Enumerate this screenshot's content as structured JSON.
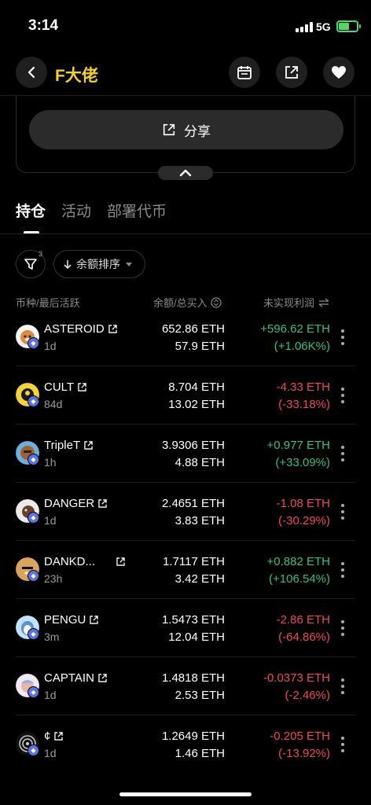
{
  "status_bar": {
    "time": "3:14",
    "network": "5G"
  },
  "header": {
    "title": "F大佬"
  },
  "share": {
    "label": "分享"
  },
  "tabs": [
    {
      "label": "持仓",
      "active": true
    },
    {
      "label": "活动",
      "active": false
    },
    {
      "label": "部署代币",
      "active": false
    }
  ],
  "filter": {
    "count": "3"
  },
  "sort": {
    "label": "余额排序"
  },
  "columns": {
    "token": "币种/最后活跃",
    "balance": "余额/总买入",
    "pnl": "未实现利润"
  },
  "colors": {
    "accent": "#f5d020",
    "positive": "#2ec27e",
    "negative": "#f0475a",
    "chain_badge": "#5b72e6"
  },
  "holdings": [
    {
      "symbol": "ASTEROID",
      "age": "1d",
      "balance": "652.86 ETH",
      "bought": "57.9 ETH",
      "pnl": "+596.62 ETH",
      "pnl_pct": "(+1.06K%)",
      "positive": true,
      "avatar": "asteroid-shiba-icon"
    },
    {
      "symbol": "CULT",
      "age": "84d",
      "balance": "8.704 ETH",
      "bought": "13.02 ETH",
      "pnl": "-4.33 ETH",
      "pnl_pct": "(-33.18%)",
      "positive": false,
      "avatar": "cult-icon"
    },
    {
      "symbol": "TripleT",
      "age": "1h",
      "balance": "3.9306 ETH",
      "bought": "4.88 ETH",
      "pnl": "+0.977 ETH",
      "pnl_pct": "(+33.09%)",
      "positive": true,
      "avatar": "triplet-icon"
    },
    {
      "symbol": "DANGER",
      "age": "1d",
      "balance": "2.4651 ETH",
      "bought": "3.83 ETH",
      "pnl": "-1.08 ETH",
      "pnl_pct": "(-30.29%)",
      "positive": false,
      "avatar": "danger-icon"
    },
    {
      "symbol": "DANKD...",
      "age": "23h",
      "balance": "1.7117 ETH",
      "bought": "3.42 ETH",
      "pnl": "+0.882 ETH",
      "pnl_pct": "(+106.54%)",
      "positive": true,
      "avatar": "dank-doge-icon"
    },
    {
      "symbol": "PENGU",
      "age": "3m",
      "balance": "1.5473 ETH",
      "bought": "12.04 ETH",
      "pnl": "-2.86 ETH",
      "pnl_pct": "(-64.86%)",
      "positive": false,
      "avatar": "pengu-icon"
    },
    {
      "symbol": "CAPTAIN",
      "age": "1d",
      "balance": "1.4818 ETH",
      "bought": "2.53 ETH",
      "pnl": "-0.0373 ETH",
      "pnl_pct": "(-2.46%)",
      "positive": false,
      "avatar": "captain-icon"
    },
    {
      "symbol": "¢",
      "age": "1d",
      "balance": "1.2649 ETH",
      "bought": "1.46 ETH",
      "pnl": "-0.205 ETH",
      "pnl_pct": "(-13.92%)",
      "positive": false,
      "avatar": "cent-icon"
    }
  ]
}
